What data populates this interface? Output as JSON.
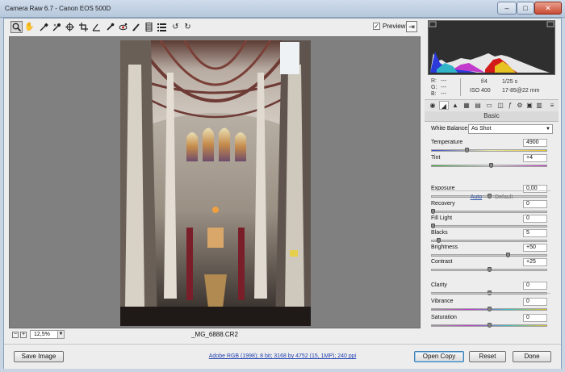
{
  "window": {
    "title": "Camera Raw 6.7  -  Canon EOS 500D"
  },
  "toolbar": {
    "tools": [
      "zoom-icon",
      "hand-icon",
      "white-balance-eyedropper-icon",
      "color-sampler-icon",
      "targeted-adjustment-icon",
      "crop-icon",
      "straighten-icon",
      "spot-removal-icon",
      "red-eye-icon",
      "adjustment-brush-icon",
      "graduated-filter-icon",
      "preferences-icon",
      "rotate-ccw-icon",
      "rotate-cw-icon"
    ],
    "preview_label": "Preview",
    "preview_checked": true
  },
  "canvas": {
    "zoom": "12,5%",
    "filename": "_MG_6888.CR2",
    "zoom_out": "−",
    "zoom_in": "+"
  },
  "info": {
    "r_label": "R:",
    "r_val": "---",
    "g_label": "G:",
    "g_val": "---",
    "b_label": "B:",
    "b_val": "---",
    "aperture": "f/4",
    "shutter": "1/25 s",
    "iso": "ISO 400",
    "lens": "17-85@22 mm"
  },
  "panel": {
    "section_title": "Basic",
    "white_balance_label": "White Balance:",
    "white_balance_value": "As Shot",
    "auto_label": "Auto",
    "default_label": "Default",
    "sliders": [
      {
        "label": "Temperature",
        "value": "4900",
        "pos": 0.3
      },
      {
        "label": "Tint",
        "value": "+4",
        "pos": 0.52
      },
      {
        "label": "Exposure",
        "value": "0,00",
        "pos": 0.5
      },
      {
        "label": "Recovery",
        "value": "0",
        "pos": 0.0
      },
      {
        "label": "Fill Light",
        "value": "0",
        "pos": 0.0
      },
      {
        "label": "Blacks",
        "value": "5",
        "pos": 0.05
      },
      {
        "label": "Brightness",
        "value": "+50",
        "pos": 0.67
      },
      {
        "label": "Contrast",
        "value": "+25",
        "pos": 0.5
      },
      {
        "label": "Clarity",
        "value": "0",
        "pos": 0.5
      },
      {
        "label": "Vibrance",
        "value": "0",
        "pos": 0.5
      },
      {
        "label": "Saturation",
        "value": "0",
        "pos": 0.5
      }
    ]
  },
  "bottom": {
    "save_label": "Save Image",
    "workflow": "Adobe RGB (1998); 8 bit; 3168 by 4752 (15, 1MP); 240 ppi",
    "open_label": "Open Copy",
    "reset_label": "Reset",
    "done_label": "Done"
  },
  "colors": {
    "accent": "#3c7fb1",
    "link": "#1f3fb0",
    "canvas": "#808080"
  }
}
